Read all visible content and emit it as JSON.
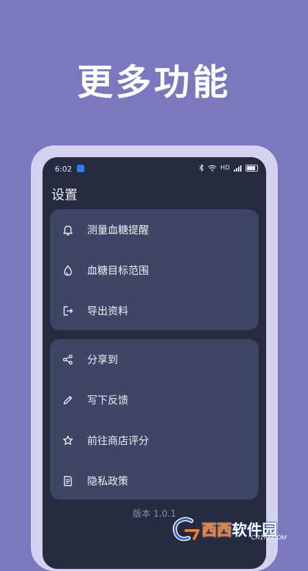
{
  "headline": "更多功能",
  "status_bar": {
    "time": "6:02",
    "network": "HD"
  },
  "settings": {
    "title": "设置",
    "group1": [
      {
        "label": "测量血糖提醒",
        "icon": "bell-icon"
      },
      {
        "label": "血糖目标范围",
        "icon": "droplet-icon"
      },
      {
        "label": "导出资料",
        "icon": "export-icon"
      }
    ],
    "group2": [
      {
        "label": "分享到",
        "icon": "share-icon"
      },
      {
        "label": "写下反馈",
        "icon": "pencil-icon"
      },
      {
        "label": "前往商店评分",
        "icon": "star-icon"
      },
      {
        "label": "隐私政策",
        "icon": "document-icon"
      }
    ],
    "version": "版本 1.0.1"
  },
  "watermark": {
    "brand_part1": "西西",
    "brand_part2": "软件园",
    "site": "CR173.COM"
  },
  "colors": {
    "background": "#7a78bf",
    "phone_frame": "#d5d2ef",
    "screen": "#262b40",
    "card": "#3e4666",
    "text": "#eceef6",
    "version_text": "#8a8fa8"
  }
}
